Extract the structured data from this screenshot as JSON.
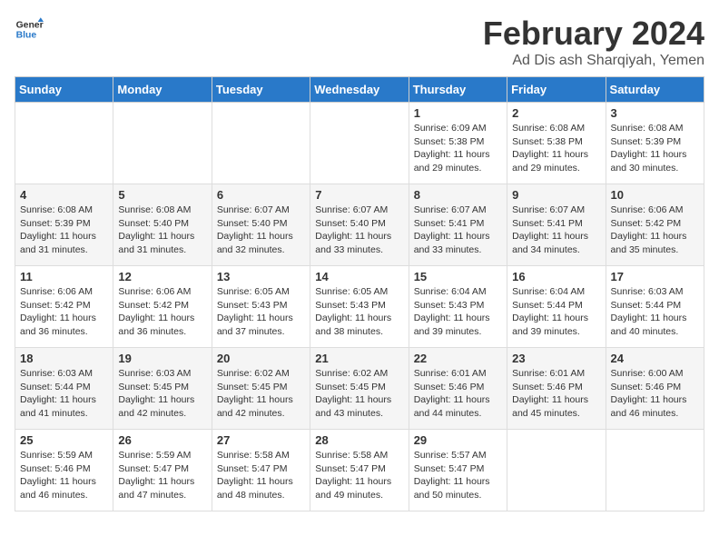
{
  "header": {
    "logo_line1": "General",
    "logo_line2": "Blue",
    "title": "February 2024",
    "subtitle": "Ad Dis ash Sharqiyah, Yemen"
  },
  "days_of_week": [
    "Sunday",
    "Monday",
    "Tuesday",
    "Wednesday",
    "Thursday",
    "Friday",
    "Saturday"
  ],
  "weeks": [
    [
      {
        "day": "",
        "info": ""
      },
      {
        "day": "",
        "info": ""
      },
      {
        "day": "",
        "info": ""
      },
      {
        "day": "",
        "info": ""
      },
      {
        "day": "1",
        "info": "Sunrise: 6:09 AM\nSunset: 5:38 PM\nDaylight: 11 hours and 29 minutes."
      },
      {
        "day": "2",
        "info": "Sunrise: 6:08 AM\nSunset: 5:38 PM\nDaylight: 11 hours and 29 minutes."
      },
      {
        "day": "3",
        "info": "Sunrise: 6:08 AM\nSunset: 5:39 PM\nDaylight: 11 hours and 30 minutes."
      }
    ],
    [
      {
        "day": "4",
        "info": "Sunrise: 6:08 AM\nSunset: 5:39 PM\nDaylight: 11 hours and 31 minutes."
      },
      {
        "day": "5",
        "info": "Sunrise: 6:08 AM\nSunset: 5:40 PM\nDaylight: 11 hours and 31 minutes."
      },
      {
        "day": "6",
        "info": "Sunrise: 6:07 AM\nSunset: 5:40 PM\nDaylight: 11 hours and 32 minutes."
      },
      {
        "day": "7",
        "info": "Sunrise: 6:07 AM\nSunset: 5:40 PM\nDaylight: 11 hours and 33 minutes."
      },
      {
        "day": "8",
        "info": "Sunrise: 6:07 AM\nSunset: 5:41 PM\nDaylight: 11 hours and 33 minutes."
      },
      {
        "day": "9",
        "info": "Sunrise: 6:07 AM\nSunset: 5:41 PM\nDaylight: 11 hours and 34 minutes."
      },
      {
        "day": "10",
        "info": "Sunrise: 6:06 AM\nSunset: 5:42 PM\nDaylight: 11 hours and 35 minutes."
      }
    ],
    [
      {
        "day": "11",
        "info": "Sunrise: 6:06 AM\nSunset: 5:42 PM\nDaylight: 11 hours and 36 minutes."
      },
      {
        "day": "12",
        "info": "Sunrise: 6:06 AM\nSunset: 5:42 PM\nDaylight: 11 hours and 36 minutes."
      },
      {
        "day": "13",
        "info": "Sunrise: 6:05 AM\nSunset: 5:43 PM\nDaylight: 11 hours and 37 minutes."
      },
      {
        "day": "14",
        "info": "Sunrise: 6:05 AM\nSunset: 5:43 PM\nDaylight: 11 hours and 38 minutes."
      },
      {
        "day": "15",
        "info": "Sunrise: 6:04 AM\nSunset: 5:43 PM\nDaylight: 11 hours and 39 minutes."
      },
      {
        "day": "16",
        "info": "Sunrise: 6:04 AM\nSunset: 5:44 PM\nDaylight: 11 hours and 39 minutes."
      },
      {
        "day": "17",
        "info": "Sunrise: 6:03 AM\nSunset: 5:44 PM\nDaylight: 11 hours and 40 minutes."
      }
    ],
    [
      {
        "day": "18",
        "info": "Sunrise: 6:03 AM\nSunset: 5:44 PM\nDaylight: 11 hours and 41 minutes."
      },
      {
        "day": "19",
        "info": "Sunrise: 6:03 AM\nSunset: 5:45 PM\nDaylight: 11 hours and 42 minutes."
      },
      {
        "day": "20",
        "info": "Sunrise: 6:02 AM\nSunset: 5:45 PM\nDaylight: 11 hours and 42 minutes."
      },
      {
        "day": "21",
        "info": "Sunrise: 6:02 AM\nSunset: 5:45 PM\nDaylight: 11 hours and 43 minutes."
      },
      {
        "day": "22",
        "info": "Sunrise: 6:01 AM\nSunset: 5:46 PM\nDaylight: 11 hours and 44 minutes."
      },
      {
        "day": "23",
        "info": "Sunrise: 6:01 AM\nSunset: 5:46 PM\nDaylight: 11 hours and 45 minutes."
      },
      {
        "day": "24",
        "info": "Sunrise: 6:00 AM\nSunset: 5:46 PM\nDaylight: 11 hours and 46 minutes."
      }
    ],
    [
      {
        "day": "25",
        "info": "Sunrise: 5:59 AM\nSunset: 5:46 PM\nDaylight: 11 hours and 46 minutes."
      },
      {
        "day": "26",
        "info": "Sunrise: 5:59 AM\nSunset: 5:47 PM\nDaylight: 11 hours and 47 minutes."
      },
      {
        "day": "27",
        "info": "Sunrise: 5:58 AM\nSunset: 5:47 PM\nDaylight: 11 hours and 48 minutes."
      },
      {
        "day": "28",
        "info": "Sunrise: 5:58 AM\nSunset: 5:47 PM\nDaylight: 11 hours and 49 minutes."
      },
      {
        "day": "29",
        "info": "Sunrise: 5:57 AM\nSunset: 5:47 PM\nDaylight: 11 hours and 50 minutes."
      },
      {
        "day": "",
        "info": ""
      },
      {
        "day": "",
        "info": ""
      }
    ]
  ]
}
